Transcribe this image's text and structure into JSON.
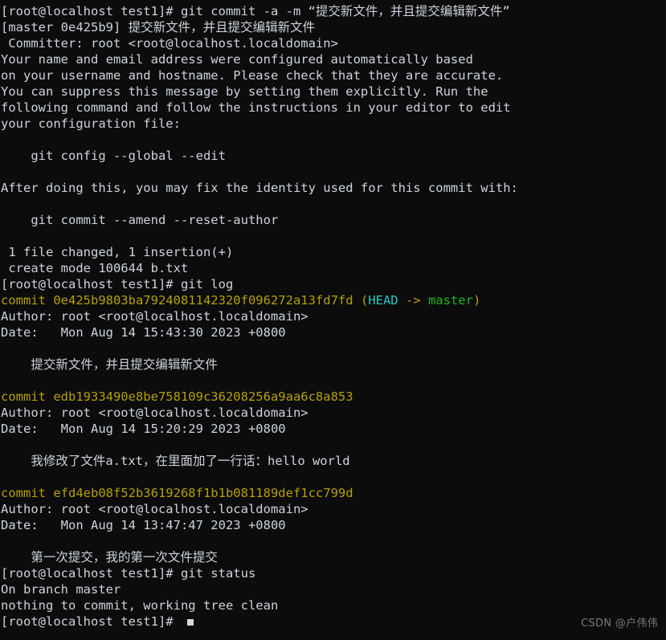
{
  "terminal": {
    "background_color": "#0c0c0c",
    "foreground_color": "#cdd3dc",
    "colors": {
      "commit_yellow": "#b5a000",
      "head_cyan": "#27c7c7",
      "branch_green": "#17b817",
      "watermark_gray": "#8c8c8c"
    },
    "prompt": "[root@localhost test1]# ",
    "lines": [
      {
        "id": "line-01",
        "segments": [
          {
            "text": "[root@localhost test1]# git commit -a -m “提交新文件，并且提交编辑新文件”",
            "color": "default"
          }
        ]
      },
      {
        "id": "line-02",
        "segments": [
          {
            "text": "[master 0e425b9] 提交新文件，并且提交编辑新文件",
            "color": "default"
          }
        ]
      },
      {
        "id": "line-03",
        "segments": [
          {
            "text": " Committer: root <root@localhost.localdomain>",
            "color": "default"
          }
        ]
      },
      {
        "id": "line-04",
        "segments": [
          {
            "text": "Your name and email address were configured automatically based",
            "color": "default"
          }
        ]
      },
      {
        "id": "line-05",
        "segments": [
          {
            "text": "on your username and hostname. Please check that they are accurate.",
            "color": "default"
          }
        ]
      },
      {
        "id": "line-06",
        "segments": [
          {
            "text": "You can suppress this message by setting them explicitly. Run the",
            "color": "default"
          }
        ]
      },
      {
        "id": "line-07",
        "segments": [
          {
            "text": "following command and follow the instructions in your editor to edit",
            "color": "default"
          }
        ]
      },
      {
        "id": "line-08",
        "segments": [
          {
            "text": "your configuration file:",
            "color": "default"
          }
        ]
      },
      {
        "id": "line-09",
        "segments": [
          {
            "text": "",
            "color": "default"
          }
        ]
      },
      {
        "id": "line-10",
        "segments": [
          {
            "text": "    git config --global --edit",
            "color": "default"
          }
        ]
      },
      {
        "id": "line-11",
        "segments": [
          {
            "text": "",
            "color": "default"
          }
        ]
      },
      {
        "id": "line-12",
        "segments": [
          {
            "text": "After doing this, you may fix the identity used for this commit with:",
            "color": "default"
          }
        ]
      },
      {
        "id": "line-13",
        "segments": [
          {
            "text": "",
            "color": "default"
          }
        ]
      },
      {
        "id": "line-14",
        "segments": [
          {
            "text": "    git commit --amend --reset-author",
            "color": "default"
          }
        ]
      },
      {
        "id": "line-15",
        "segments": [
          {
            "text": "",
            "color": "default"
          }
        ]
      },
      {
        "id": "line-16",
        "segments": [
          {
            "text": " 1 file changed, 1 insertion(+)",
            "color": "default"
          }
        ]
      },
      {
        "id": "line-17",
        "segments": [
          {
            "text": " create mode 100644 b.txt",
            "color": "default"
          }
        ]
      },
      {
        "id": "line-18",
        "segments": [
          {
            "text": "[root@localhost test1]# git log",
            "color": "default"
          }
        ]
      },
      {
        "id": "line-19",
        "segments": [
          {
            "text": "commit 0e425b9803ba7924081142320f096272a13fd7fd ",
            "color": "yellow"
          },
          {
            "text": "(",
            "color": "yellow"
          },
          {
            "text": "HEAD",
            "color": "cyan"
          },
          {
            "text": " -> ",
            "color": "yellow"
          },
          {
            "text": "master",
            "color": "green"
          },
          {
            "text": ")",
            "color": "yellow"
          }
        ]
      },
      {
        "id": "line-20",
        "segments": [
          {
            "text": "Author: root <root@localhost.localdomain>",
            "color": "default"
          }
        ]
      },
      {
        "id": "line-21",
        "segments": [
          {
            "text": "Date:   Mon Aug 14 15:43:30 2023 +0800",
            "color": "default"
          }
        ]
      },
      {
        "id": "line-22",
        "segments": [
          {
            "text": "",
            "color": "default"
          }
        ]
      },
      {
        "id": "line-23",
        "segments": [
          {
            "text": "    提交新文件，并且提交编辑新文件",
            "color": "default"
          }
        ]
      },
      {
        "id": "line-24",
        "segments": [
          {
            "text": "",
            "color": "default"
          }
        ]
      },
      {
        "id": "line-25",
        "segments": [
          {
            "text": "commit edb1933490e8be758109c36208256a9aa6c8a853",
            "color": "yellow"
          }
        ]
      },
      {
        "id": "line-26",
        "segments": [
          {
            "text": "Author: root <root@localhost.localdomain>",
            "color": "default"
          }
        ]
      },
      {
        "id": "line-27",
        "segments": [
          {
            "text": "Date:   Mon Aug 14 15:20:29 2023 +0800",
            "color": "default"
          }
        ]
      },
      {
        "id": "line-28",
        "segments": [
          {
            "text": "",
            "color": "default"
          }
        ]
      },
      {
        "id": "line-29",
        "segments": [
          {
            "text": "    我修改了文件a.txt，在里面加了一行话：hello world",
            "color": "default"
          }
        ]
      },
      {
        "id": "line-30",
        "segments": [
          {
            "text": "",
            "color": "default"
          }
        ]
      },
      {
        "id": "line-31",
        "segments": [
          {
            "text": "commit efd4eb08f52b3619268f1b1b081189def1cc799d",
            "color": "yellow"
          }
        ]
      },
      {
        "id": "line-32",
        "segments": [
          {
            "text": "Author: root <root@localhost.localdomain>",
            "color": "default"
          }
        ]
      },
      {
        "id": "line-33",
        "segments": [
          {
            "text": "Date:   Mon Aug 14 13:47:47 2023 +0800",
            "color": "default"
          }
        ]
      },
      {
        "id": "line-34",
        "segments": [
          {
            "text": "",
            "color": "default"
          }
        ]
      },
      {
        "id": "line-35",
        "segments": [
          {
            "text": "    第一次提交，我的第一次文件提交",
            "color": "default"
          }
        ]
      },
      {
        "id": "line-36",
        "segments": [
          {
            "text": "[root@localhost test1]# git status",
            "color": "default"
          }
        ]
      },
      {
        "id": "line-37",
        "segments": [
          {
            "text": "On branch master",
            "color": "default"
          }
        ]
      },
      {
        "id": "line-38",
        "segments": [
          {
            "text": "nothing to commit, working tree clean",
            "color": "default"
          }
        ]
      },
      {
        "id": "line-39",
        "segments": [
          {
            "text": "[root@localhost test1]# ",
            "color": "default"
          }
        ],
        "cursor": true
      }
    ]
  },
  "watermark": {
    "text": "CSDN @户伟伟"
  }
}
